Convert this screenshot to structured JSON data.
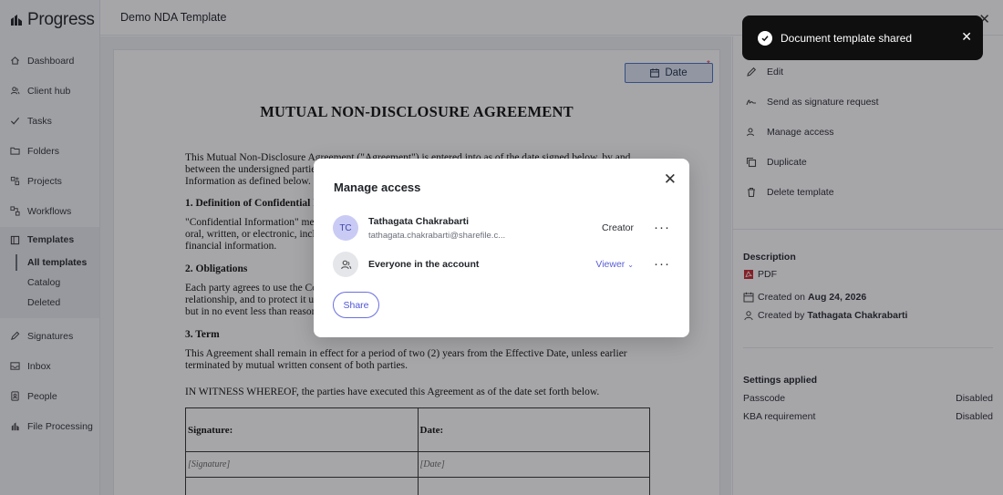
{
  "app": {
    "brand": "Progress S"
  },
  "sidebar": {
    "items": [
      {
        "label": "Dashboard",
        "icon": "home-icon"
      },
      {
        "label": "Client hub",
        "icon": "users-icon"
      },
      {
        "label": "Tasks",
        "icon": "check-icon"
      },
      {
        "label": "Folders",
        "icon": "folder-icon"
      },
      {
        "label": "Projects",
        "icon": "projects-icon"
      },
      {
        "label": "Workflows",
        "icon": "workflow-icon"
      }
    ],
    "templates": {
      "label": "Templates",
      "sub": [
        "All templates",
        "Catalog",
        "Deleted"
      ],
      "active": "All templates"
    },
    "items_after": [
      {
        "label": "Signatures",
        "icon": "pen-icon"
      },
      {
        "label": "Inbox",
        "icon": "inbox-icon"
      },
      {
        "label": "People",
        "icon": "people-icon"
      },
      {
        "label": "File Processing",
        "icon": "file-processing-icon"
      }
    ]
  },
  "header": {
    "title": "Demo NDA Template"
  },
  "document": {
    "date_field": "Date",
    "required_mark": "*",
    "title": "MUTUAL NON-DISCLOSURE AGREEMENT",
    "intro_1": "This Mutual Non-Disclosure Agreement (\"Agreement\") is entered into as of the date signed below, by and",
    "intro_2": "between the undersigned parties",
    "intro_3": "Information as defined below.",
    "h1": "1. Definition of Confidential I",
    "p1_1": "\"Confidential Information\" me",
    "p1_2": "oral, written, or electronic, incl",
    "p1_3": "financial information.",
    "h2": "2. Obligations",
    "p2_1": "Each party agrees to use the Co",
    "p2_2": "relationship, and to protect it us",
    "p2_3": "but in no event less than reason",
    "h3": "3. Term",
    "p3_1": "This Agreement shall remain in effect for a period of two (2) years from the Effective Date, unless earlier",
    "p3_2": "terminated by mutual written consent of both parties.",
    "witness": "IN WITNESS WHEREOF, the parties have executed this Agreement as of the date set forth below.",
    "sig_label": "Signature:",
    "date_label": "Date:",
    "sig_placeholder": "[Signature]",
    "date_placeholder": "[Date]"
  },
  "panel": {
    "actions": [
      "Edit",
      "Send as signature request",
      "Manage access",
      "Duplicate",
      "Delete template"
    ],
    "description_title": "Description",
    "file_type": "PDF",
    "created_on_label": "Created on",
    "created_on": "Aug 24, 2026",
    "created_by_label": "Created by",
    "created_by": "Tathagata Chakrabarti",
    "settings_title": "Settings applied",
    "settings": [
      {
        "label": "Passcode",
        "value": "Disabled"
      },
      {
        "label": "KBA requirement",
        "value": "Disabled"
      }
    ]
  },
  "toast": {
    "message": "Document template shared"
  },
  "modal": {
    "title": "Manage access",
    "members": [
      {
        "initials": "TC",
        "name": "Tathagata Chakrabarti",
        "email": "tathagata.chakrabarti@sharefile.c...",
        "role": "Creator"
      },
      {
        "name": "Everyone in the account",
        "role": "Viewer"
      }
    ],
    "more_glyph": "···",
    "share_label": "Share"
  },
  "colors": {
    "accent": "#5a5fd6",
    "toast_bg": "#0f0f10",
    "avatar_bg": "#c9cbf5",
    "date_field": "#4a72c4"
  }
}
